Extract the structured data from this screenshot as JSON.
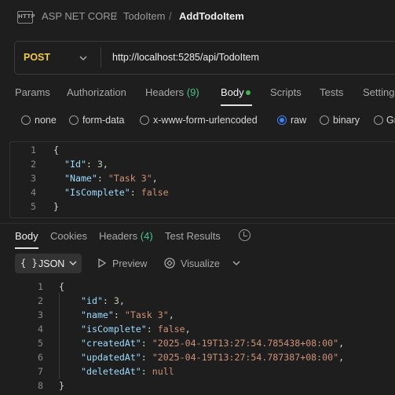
{
  "breadcrumb": {
    "icon_text": "HTTP",
    "items": [
      "ASP NET CORE",
      "TodoItem",
      "AddTodoItem"
    ],
    "separator": "/"
  },
  "request": {
    "method": "POST",
    "url": "http://localhost:5285/api/TodoItem",
    "method_color": "#f2c94c"
  },
  "request_tabs": [
    {
      "label": "Params"
    },
    {
      "label": "Authorization"
    },
    {
      "label": "Headers",
      "count": "(9)"
    },
    {
      "label": "Body",
      "active": true
    },
    {
      "label": "Scripts"
    },
    {
      "label": "Tests"
    },
    {
      "label": "Settings"
    }
  ],
  "body_types": [
    {
      "label": "none",
      "selected": false
    },
    {
      "label": "form-data",
      "selected": false
    },
    {
      "label": "x-www-form-urlencoded",
      "selected": false
    },
    {
      "label": "raw",
      "selected": true
    },
    {
      "label": "binary",
      "selected": false
    },
    {
      "label": "GraphQL",
      "selected": false
    }
  ],
  "request_body": {
    "line_numbers": [
      "1",
      "2",
      "3",
      "4",
      "5"
    ],
    "lines": [
      [
        {
          "t": "punc",
          "v": "{"
        }
      ],
      [
        {
          "t": "key",
          "v": "\"Id\""
        },
        {
          "t": "punc",
          "v": ": "
        },
        {
          "t": "num",
          "v": "3"
        },
        {
          "t": "punc",
          "v": ","
        }
      ],
      [
        {
          "t": "key",
          "v": "\"Name\""
        },
        {
          "t": "punc",
          "v": ": "
        },
        {
          "t": "str",
          "v": "\"Task 3\""
        },
        {
          "t": "punc",
          "v": ","
        }
      ],
      [
        {
          "t": "key",
          "v": "\"IsComplete\""
        },
        {
          "t": "punc",
          "v": ": "
        },
        {
          "t": "bool",
          "v": "false"
        }
      ],
      [
        {
          "t": "punc",
          "v": "}"
        }
      ]
    ]
  },
  "response_tabs": [
    {
      "label": "Body",
      "active": true
    },
    {
      "label": "Cookies"
    },
    {
      "label": "Headers",
      "count": "(4)"
    },
    {
      "label": "Test Results"
    }
  ],
  "response_toolbar": {
    "format_icon": "{ }",
    "format_label": "JSON",
    "preview_label": "Preview",
    "visualize_label": "Visualize"
  },
  "response_body": {
    "line_numbers": [
      "1",
      "2",
      "3",
      "4",
      "5",
      "6",
      "7",
      "8"
    ],
    "lines": [
      [
        {
          "t": "punc",
          "v": "{"
        }
      ],
      [
        {
          "t": "key",
          "v": "\"id\""
        },
        {
          "t": "punc",
          "v": ": "
        },
        {
          "t": "num",
          "v": "3"
        },
        {
          "t": "punc",
          "v": ","
        }
      ],
      [
        {
          "t": "key",
          "v": "\"name\""
        },
        {
          "t": "punc",
          "v": ": "
        },
        {
          "t": "str",
          "v": "\"Task 3\""
        },
        {
          "t": "punc",
          "v": ","
        }
      ],
      [
        {
          "t": "key",
          "v": "\"isComplete\""
        },
        {
          "t": "punc",
          "v": ": "
        },
        {
          "t": "bool",
          "v": "false"
        },
        {
          "t": "punc",
          "v": ","
        }
      ],
      [
        {
          "t": "key",
          "v": "\"createdAt\""
        },
        {
          "t": "punc",
          "v": ": "
        },
        {
          "t": "str",
          "v": "\"2025-04-19T13:27:54.785438+08:00\""
        },
        {
          "t": "punc",
          "v": ","
        }
      ],
      [
        {
          "t": "key",
          "v": "\"updatedAt\""
        },
        {
          "t": "punc",
          "v": ": "
        },
        {
          "t": "str",
          "v": "\"2025-04-19T13:27:54.787387+08:00\""
        },
        {
          "t": "punc",
          "v": ","
        }
      ],
      [
        {
          "t": "key",
          "v": "\"deletedAt\""
        },
        {
          "t": "punc",
          "v": ": "
        },
        {
          "t": "bool",
          "v": "null"
        }
      ],
      [
        {
          "t": "punc",
          "v": "}"
        }
      ]
    ]
  },
  "colors": {
    "background": "#1e1e1e",
    "accent_green": "#4cc38a",
    "radio_selected": "#3b82f6"
  }
}
